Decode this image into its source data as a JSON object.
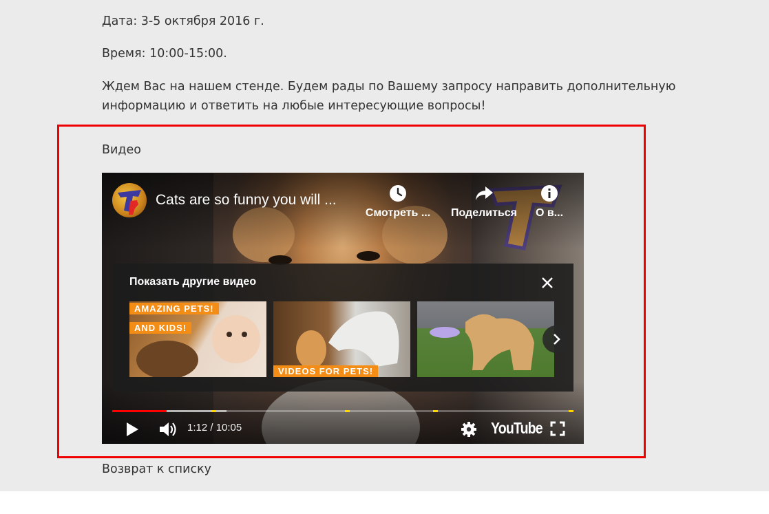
{
  "page": {
    "date_line": "Дата: 3-5 октября 2016 г.",
    "time_line": "Время: 10:00-15:00.",
    "invite_text": "Ждем Вас на нашем стенде. Будем рады по Вашему запросу направить дополнительную информацию и ответить на любые интересующие вопросы!",
    "video_section_label": "Видео",
    "back_link": "Возврат к списку",
    "highlight_color": "#ee0000"
  },
  "player": {
    "video_title": "Cats are so funny you will ...",
    "channel_avatar_icon": "channel-logo-icon",
    "actions": {
      "watch_later": "Смотреть ...",
      "share": "Поделиться",
      "about": "О в..."
    },
    "more_videos": {
      "title": "Показать другие видео",
      "thumbnails": [
        {
          "badge_1": "AMAZING PETS!",
          "badge_2": "AND KIDS!"
        },
        {
          "badge_1": "VIDEOS FOR PETS!"
        },
        {
          "badge_1": ""
        }
      ]
    },
    "progress": {
      "played_fraction": 0.118,
      "buffered_fraction": 0.248,
      "marker_fractions": [
        0.215,
        0.505,
        0.695,
        0.992
      ],
      "played_color": "#ff0000",
      "marker_color": "#ffd600"
    },
    "time_display": "1:12 / 10:05",
    "logo_text": "YouTube"
  }
}
